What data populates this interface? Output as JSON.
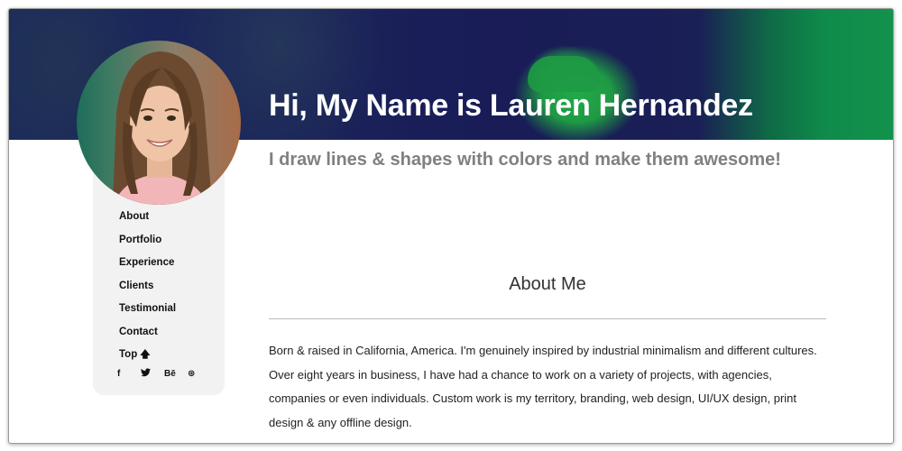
{
  "hero": {
    "title": "Hi, My Name is Lauren Hernandez",
    "tagline": "I draw lines & shapes with colors and make them awesome!",
    "colors": {
      "dark": "#1a235a",
      "green": "#12924c"
    }
  },
  "nav": {
    "items": [
      {
        "label": "About"
      },
      {
        "label": "Portfolio"
      },
      {
        "label": "Experience"
      },
      {
        "label": "Clients"
      },
      {
        "label": "Testimonial"
      },
      {
        "label": "Contact"
      },
      {
        "label": "Top"
      }
    ],
    "top_icon": "arrow-up-icon"
  },
  "social": [
    {
      "name": "facebook-icon",
      "glyph": "f"
    },
    {
      "name": "twitter-icon",
      "glyph": "🐦"
    },
    {
      "name": "behance-icon",
      "glyph": "Bē"
    },
    {
      "name": "dribbble-icon",
      "glyph": "⊛"
    }
  ],
  "about": {
    "heading": "About Me",
    "body": "Born & raised in California, America. I'm genuinely inspired by industrial minimalism and different cultures. Over eight years in business, I have had a chance to work on a variety of projects, with agencies, companies or even individuals. Custom work is my territory, branding, web design, UI/UX design, print design & any offline design."
  }
}
